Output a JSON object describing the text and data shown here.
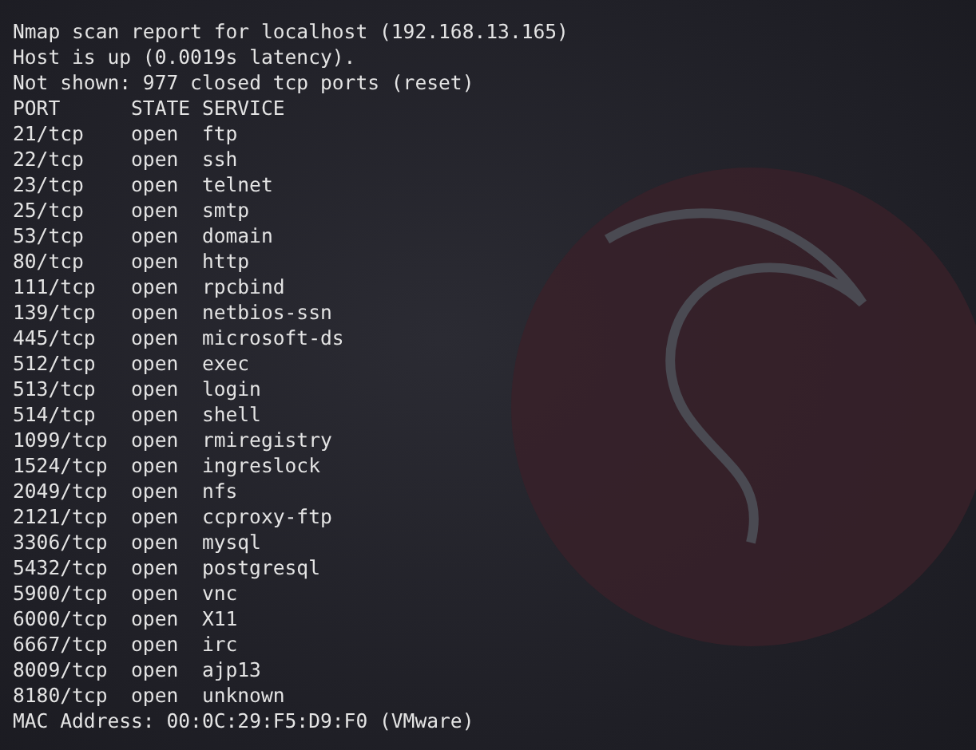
{
  "terminal": {
    "report_line": "Nmap scan report for localhost (192.168.13.165)",
    "host_line": "Host is up (0.0019s latency).",
    "not_shown_line": "Not shown: 977 closed tcp ports (reset)",
    "columns": [
      "PORT",
      "STATE",
      "SERVICE"
    ],
    "rows": [
      {
        "port": "21/tcp",
        "state": "open",
        "service": "ftp"
      },
      {
        "port": "22/tcp",
        "state": "open",
        "service": "ssh"
      },
      {
        "port": "23/tcp",
        "state": "open",
        "service": "telnet"
      },
      {
        "port": "25/tcp",
        "state": "open",
        "service": "smtp"
      },
      {
        "port": "53/tcp",
        "state": "open",
        "service": "domain"
      },
      {
        "port": "80/tcp",
        "state": "open",
        "service": "http"
      },
      {
        "port": "111/tcp",
        "state": "open",
        "service": "rpcbind"
      },
      {
        "port": "139/tcp",
        "state": "open",
        "service": "netbios-ssn"
      },
      {
        "port": "445/tcp",
        "state": "open",
        "service": "microsoft-ds"
      },
      {
        "port": "512/tcp",
        "state": "open",
        "service": "exec"
      },
      {
        "port": "513/tcp",
        "state": "open",
        "service": "login"
      },
      {
        "port": "514/tcp",
        "state": "open",
        "service": "shell"
      },
      {
        "port": "1099/tcp",
        "state": "open",
        "service": "rmiregistry"
      },
      {
        "port": "1524/tcp",
        "state": "open",
        "service": "ingreslock"
      },
      {
        "port": "2049/tcp",
        "state": "open",
        "service": "nfs"
      },
      {
        "port": "2121/tcp",
        "state": "open",
        "service": "ccproxy-ftp"
      },
      {
        "port": "3306/tcp",
        "state": "open",
        "service": "mysql"
      },
      {
        "port": "5432/tcp",
        "state": "open",
        "service": "postgresql"
      },
      {
        "port": "5900/tcp",
        "state": "open",
        "service": "vnc"
      },
      {
        "port": "6000/tcp",
        "state": "open",
        "service": "X11"
      },
      {
        "port": "6667/tcp",
        "state": "open",
        "service": "irc"
      },
      {
        "port": "8009/tcp",
        "state": "open",
        "service": "ajp13"
      },
      {
        "port": "8180/tcp",
        "state": "open",
        "service": "unknown"
      }
    ],
    "mac_line": "MAC Address: 00:0C:29:F5:D9:F0 (VMware)"
  }
}
